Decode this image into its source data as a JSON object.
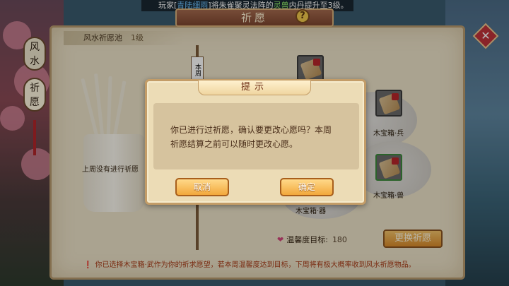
{
  "ticker": {
    "prefix": "玩家[",
    "player": "青陆细雨",
    "middle": "]将朱雀聚灵法阵的",
    "item": "灵兽",
    "suffix": "内丹提升至3级。"
  },
  "header": {
    "title": "祈愿",
    "help_label": "?"
  },
  "side_tabs": [
    {
      "label_top": "风",
      "label_bottom": "水"
    },
    {
      "label_top": "祈",
      "label_bottom": "愿"
    }
  ],
  "pool": {
    "name": "风水祈愿池",
    "level": "1级",
    "last_week_text": "上周没有进行祈愿",
    "scroll_tag": "本周"
  },
  "rewards": [
    {
      "label": "木宝箱·兵"
    },
    {
      "label": "木宝箱·兽"
    },
    {
      "label": "木宝箱·器"
    }
  ],
  "warmth": {
    "label": "温馨度目标:",
    "value": "180"
  },
  "change_wish_button": "更换祈愿",
  "footer_note": "你已选择木宝箱·武作为你的祈求愿望，若本周温馨度达到目标，下周将有极大概率收到风水祈愿物品。",
  "close_icon_glyph": "✕",
  "dialog": {
    "title": "提示",
    "message_line1": "你已进行过祈愿，确认要更改心愿吗？本周",
    "message_line2": "祈愿结算之前可以随时更改心愿。",
    "cancel_label": "取消",
    "confirm_label": "确定"
  },
  "colors": {
    "accent": "#f2a83c",
    "dialog_bg": "#ecdcb6",
    "panel_bg": "#ece2c8",
    "warning": "#a83a16"
  }
}
